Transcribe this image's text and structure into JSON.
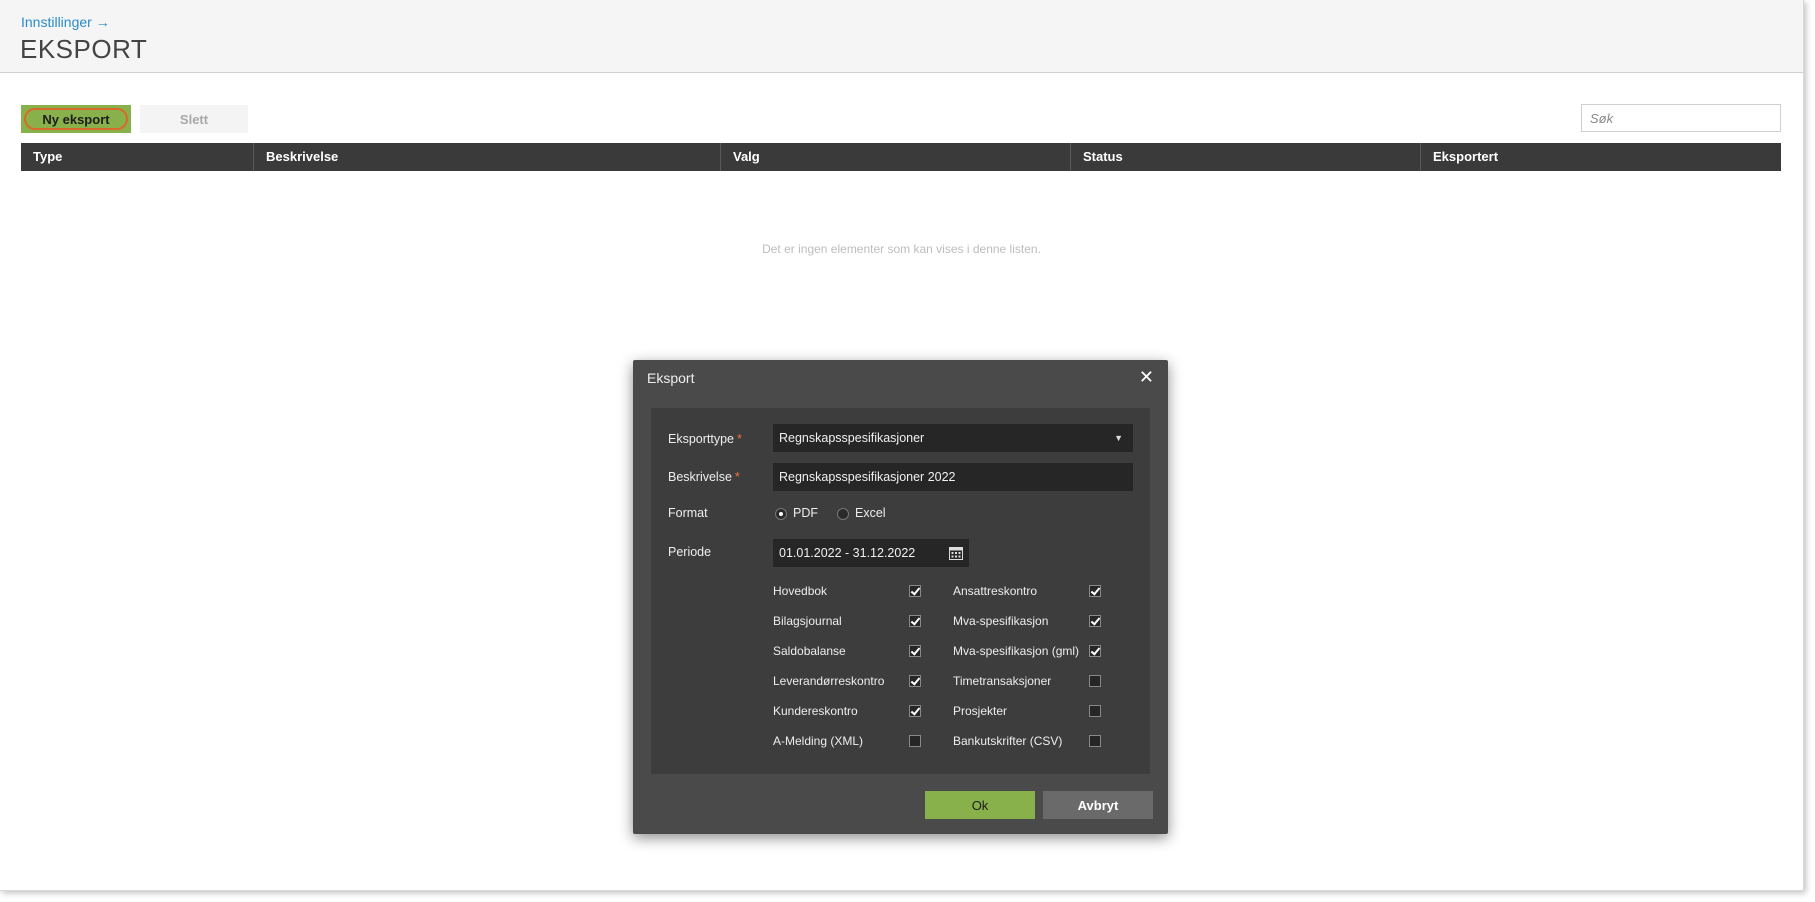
{
  "header": {
    "breadcrumb": "Innstillinger →",
    "title": "EKSPORT"
  },
  "toolbar": {
    "new_label": "Ny eksport",
    "delete_label": "Slett",
    "search_placeholder": "Søk"
  },
  "table": {
    "columns": [
      "Type",
      "Beskrivelse",
      "Valg",
      "Status",
      "Eksportert"
    ],
    "empty_message": "Det er ingen elementer som kan vises i denne listen."
  },
  "modal": {
    "title": "Eksport",
    "close_glyph": "✕",
    "fields": {
      "export_type_label": "Eksporttype",
      "export_type_value": "Regnskapsspesifikasjoner",
      "description_label": "Beskrivelse",
      "description_value": "Regnskapsspesifikasjoner 2022",
      "required_mark": "*",
      "format_label": "Format",
      "format_options": [
        "PDF",
        "Excel"
      ],
      "format_selected": "PDF",
      "period_label": "Periode",
      "period_value": "01.01.2022 - 31.12.2022"
    },
    "checkboxes_left": [
      {
        "label": "Hovedbok",
        "checked": true
      },
      {
        "label": "Bilagsjournal",
        "checked": true
      },
      {
        "label": "Saldobalanse",
        "checked": true
      },
      {
        "label": "Leverandørreskontro",
        "checked": true
      },
      {
        "label": "Kundereskontro",
        "checked": true
      },
      {
        "label": "A-Melding (XML)",
        "checked": false
      }
    ],
    "checkboxes_right": [
      {
        "label": "Ansattreskontro",
        "checked": true
      },
      {
        "label": "Mva-spesifikasjon",
        "checked": true
      },
      {
        "label": "Mva-spesifikasjon (gml)",
        "checked": true
      },
      {
        "label": "Timetransaksjoner",
        "checked": false
      },
      {
        "label": "Prosjekter",
        "checked": false
      },
      {
        "label": "Bankutskrifter (CSV)",
        "checked": false
      }
    ],
    "ok_label": "Ok",
    "cancel_label": "Avbryt"
  },
  "colors": {
    "accent_green": "#88b04b",
    "focus_ring": "#d9692b",
    "link_blue": "#2a8bc9",
    "required_orange": "#e8743b"
  }
}
